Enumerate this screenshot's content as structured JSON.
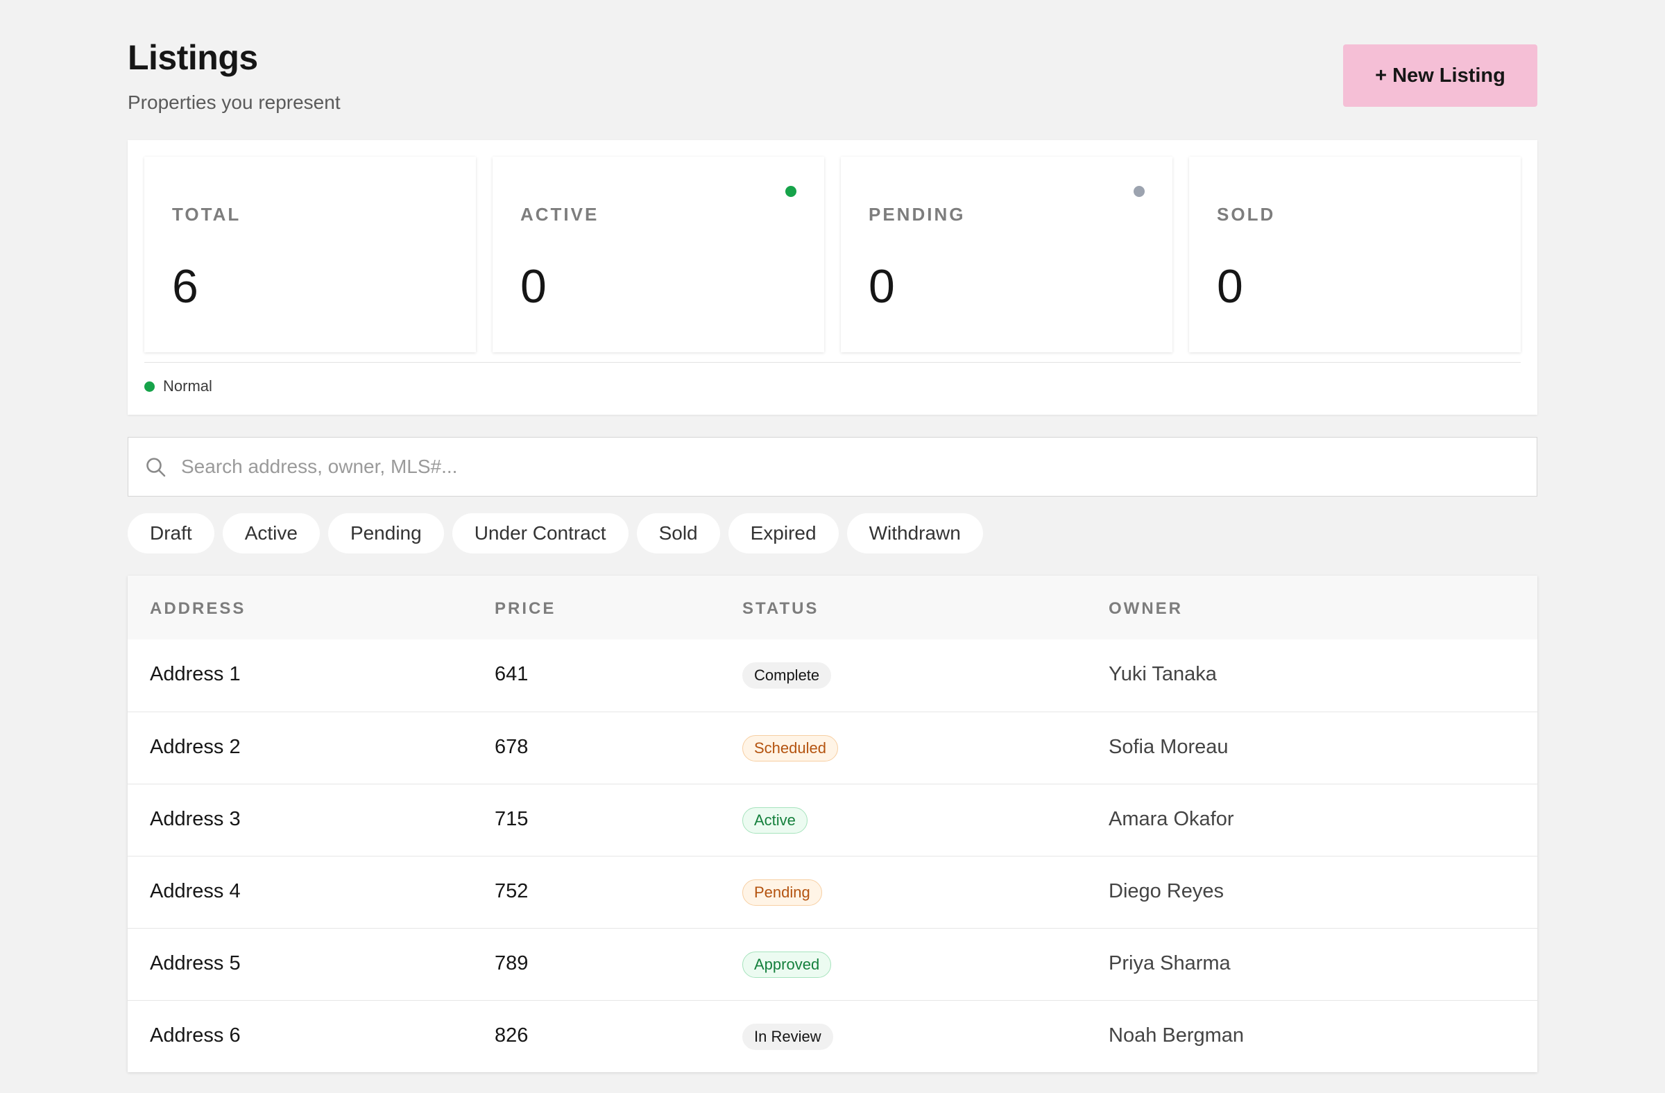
{
  "header": {
    "title": "Listings",
    "subtitle": "Properties you represent",
    "new_button_label": "+ New Listing"
  },
  "stats": [
    {
      "label": "TOTAL",
      "value": "6",
      "dot_color": null
    },
    {
      "label": "ACTIVE",
      "value": "0",
      "dot_color": "#16a34a"
    },
    {
      "label": "PENDING",
      "value": "0",
      "dot_color": "#9ca3af"
    },
    {
      "label": "SOLD",
      "value": "0",
      "dot_color": null
    }
  ],
  "legend": {
    "label": "Normal",
    "color": "#16a34a"
  },
  "search": {
    "placeholder": "Search address, owner, MLS#...",
    "value": "",
    "icon": "search-icon"
  },
  "filters": [
    "Draft",
    "Active",
    "Pending",
    "Under Contract",
    "Sold",
    "Expired",
    "Withdrawn"
  ],
  "table": {
    "columns": [
      "ADDRESS",
      "PRICE",
      "STATUS",
      "OWNER"
    ],
    "rows": [
      {
        "address": "Address 1",
        "price": "641",
        "status": "Complete",
        "status_tone": "neutral",
        "owner": "Yuki Tanaka"
      },
      {
        "address": "Address 2",
        "price": "678",
        "status": "Scheduled",
        "status_tone": "warn",
        "owner": "Sofia Moreau"
      },
      {
        "address": "Address 3",
        "price": "715",
        "status": "Active",
        "status_tone": "good",
        "owner": "Amara Okafor"
      },
      {
        "address": "Address 4",
        "price": "752",
        "status": "Pending",
        "status_tone": "warn",
        "owner": "Diego Reyes"
      },
      {
        "address": "Address 5",
        "price": "789",
        "status": "Approved",
        "status_tone": "good",
        "owner": "Priya Sharma"
      },
      {
        "address": "Address 6",
        "price": "826",
        "status": "In Review",
        "status_tone": "neutral",
        "owner": "Noah Bergman"
      }
    ]
  },
  "colors": {
    "accent_button": "#f5bfd6",
    "page_background": "#f2f2f2",
    "status_good": "#15803d",
    "status_warn": "#b4530f"
  }
}
